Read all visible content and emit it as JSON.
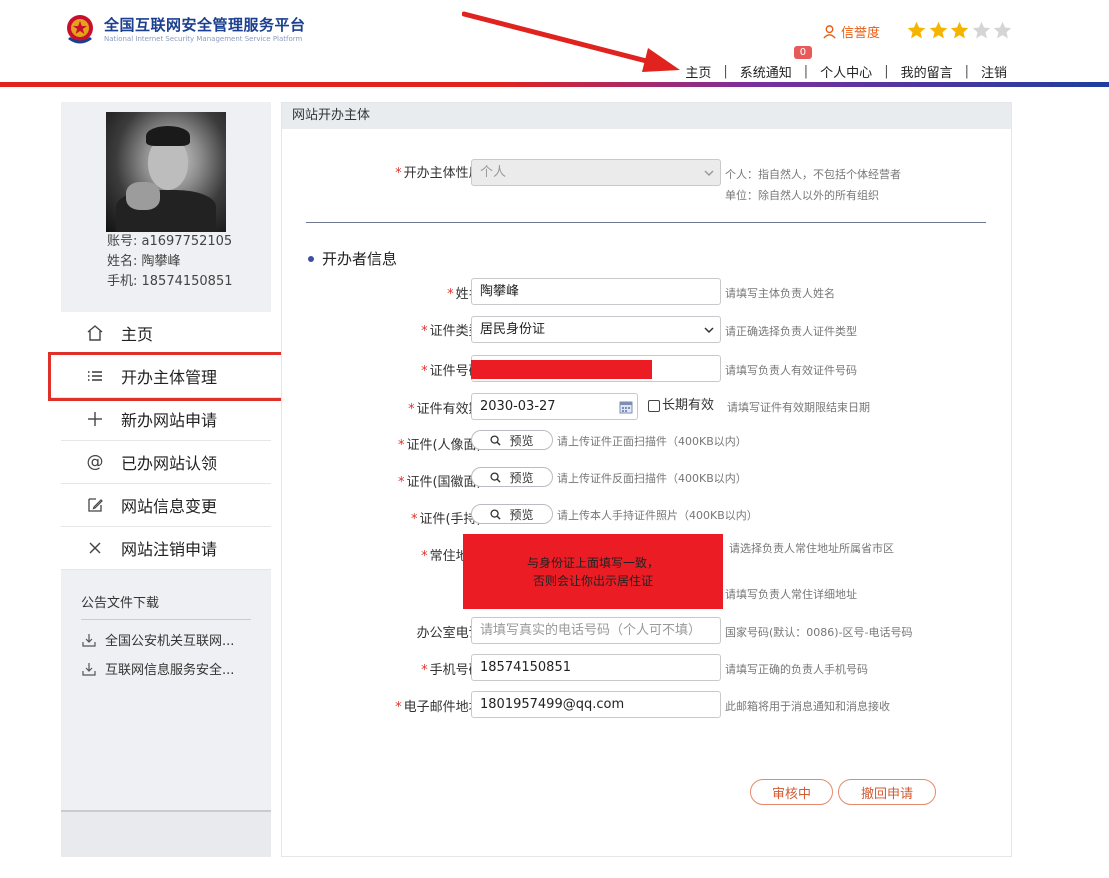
{
  "header": {
    "logo_cn": "全国互联网安全管理服务平台",
    "logo_en": "National Internet Security Management Service Platform",
    "credit_label": "信誉度",
    "rating": 3,
    "rating_max": 5,
    "nav": [
      {
        "label": "主页"
      },
      {
        "label": "系统通知",
        "badge": "0"
      },
      {
        "label": "个人中心"
      },
      {
        "label": "我的留言"
      },
      {
        "label": "注销"
      }
    ],
    "nav_separator": "|"
  },
  "sidebar": {
    "account": "账号:  a1697752105",
    "name": "姓名:  陶攀峰",
    "phone": "手机:  18574150851",
    "menu": [
      {
        "label": "主页",
        "icon": "home-icon"
      },
      {
        "label": "开办主体管理",
        "icon": "list-icon"
      },
      {
        "label": "新办网站申请",
        "icon": "plus-icon"
      },
      {
        "label": "已办网站认领",
        "icon": "at-icon"
      },
      {
        "label": "网站信息变更",
        "icon": "edit-icon"
      },
      {
        "label": "网站注销申请",
        "icon": "close-icon"
      }
    ],
    "downloads_title": "公告文件下载",
    "downloads": [
      {
        "label": "全国公安机关互联网..."
      },
      {
        "label": "互联网信息服务安全..."
      }
    ]
  },
  "panel": {
    "title": "网站开办主体",
    "entity_type": {
      "label": "开办主体性质:",
      "value": "个人",
      "hint1": "个人：指自然人，不包括个体经营者",
      "hint2": "单位：除自然人以外的所有组织"
    },
    "section_title": "开办者信息",
    "name": {
      "label": "姓名:",
      "value": "陶攀峰",
      "hint": "请填写主体负责人姓名"
    },
    "id_type": {
      "label": "证件类型:",
      "value": "居民身份证",
      "hint": "请正确选择负责人证件类型"
    },
    "id_number": {
      "label": "证件号码:",
      "hint": "请填写负责人有效证件号码"
    },
    "id_expiry": {
      "label": "证件有效期:",
      "value": "2030-03-27",
      "long_term": "长期有效",
      "hint": "请填写证件有效期限结束日期"
    },
    "id_front": {
      "label": "证件(人像面):",
      "button": "预览",
      "hint": "请上传证件正面扫描件（400KB以内）"
    },
    "id_back": {
      "label": "证件(国徽面):",
      "button": "预览",
      "hint": "请上传证件反面扫描件（400KB以内）"
    },
    "id_hand": {
      "label": "证件(手持):",
      "button": "预览",
      "hint": "请上传本人手持证件照片（400KB以内）"
    },
    "address": {
      "label": "常住地址:",
      "note1": "与身份证上面填写一致，",
      "note2": "否则会让你出示居住证",
      "hint1": "请选择负责人常住地址所属省市区",
      "hint2": "请填写负责人常住详细地址"
    },
    "office_phone": {
      "label": "办公室电话:",
      "placeholder": "请填写真实的电话号码（个人可不填）",
      "hint": "国家号码(默认：0086)-区号-电话号码"
    },
    "mobile": {
      "label": "手机号码:",
      "value": "18574150851",
      "hint": "请填写正确的负责人手机号码"
    },
    "email": {
      "label": "电子邮件地址:",
      "value": "1801957499@qq.com",
      "hint": "此邮箱将用于消息通知和消息接收"
    },
    "status_button": "审核中",
    "withdraw_button": "撤回申请"
  },
  "colors": {
    "brand_blue": "#1b3f8f",
    "accent_red": "#e0231f",
    "credit_orange": "#e85d12",
    "star_gold": "#f5b400"
  }
}
